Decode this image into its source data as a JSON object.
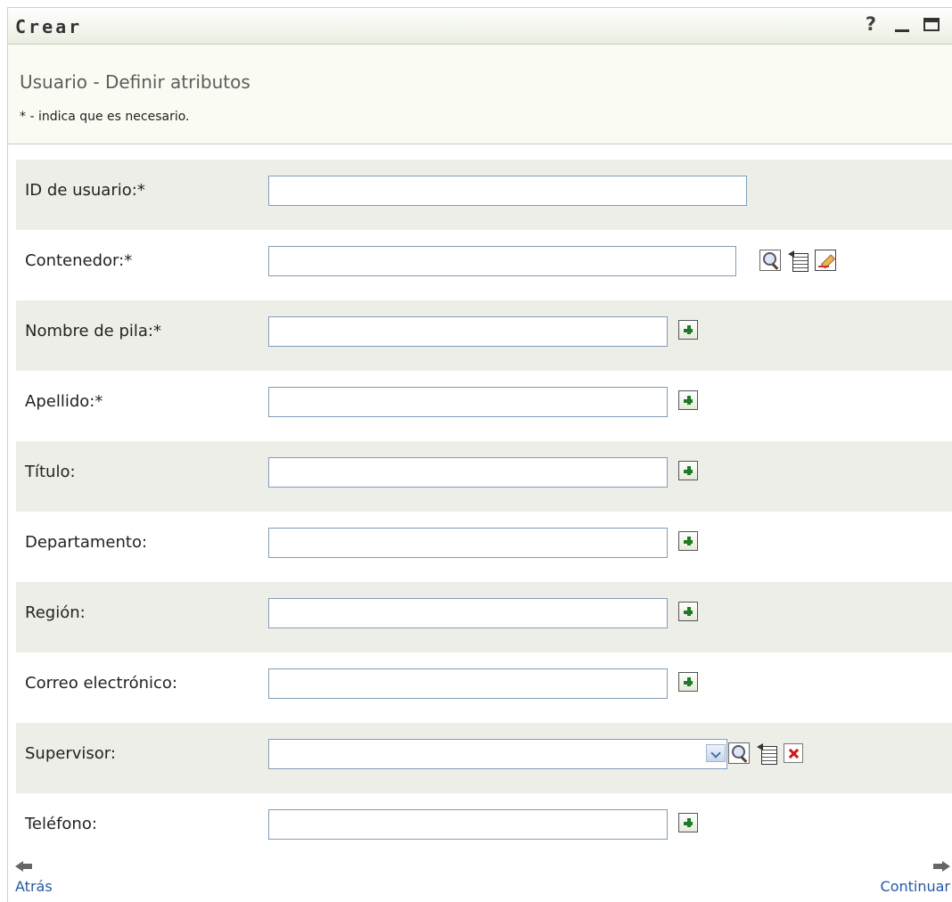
{
  "window": {
    "title": "Crear",
    "help_label": "?",
    "icons": [
      "help-icon",
      "minimize-icon",
      "maximize-icon"
    ]
  },
  "header": {
    "page_title": "Usuario - Definir atributos",
    "required_note": "* - indica que es necesario."
  },
  "form": {
    "fields": [
      {
        "label": "ID de usuario:*",
        "value": "",
        "actions": []
      },
      {
        "label": "Contenedor:*",
        "value": "",
        "actions": [
          "search-icon",
          "history-icon",
          "edit-icon"
        ]
      },
      {
        "label": "Nombre de pila:*",
        "value": "",
        "actions": [
          "plus-icon"
        ]
      },
      {
        "label": "Apellido:*",
        "value": "",
        "actions": [
          "plus-icon"
        ]
      },
      {
        "label": "Título:",
        "value": "",
        "actions": [
          "plus-icon"
        ]
      },
      {
        "label": "Departamento:",
        "value": "",
        "actions": [
          "plus-icon"
        ]
      },
      {
        "label": "Región:",
        "value": "",
        "actions": [
          "plus-icon"
        ]
      },
      {
        "label": "Correo electrónico:",
        "value": "",
        "actions": [
          "plus-icon"
        ]
      },
      {
        "label": "Supervisor:",
        "value": "",
        "actions": [
          "chevron-down-icon",
          "search-icon",
          "history-icon",
          "clear-icon"
        ]
      },
      {
        "label": "Teléfono:",
        "value": "",
        "actions": [
          "plus-icon"
        ]
      }
    ]
  },
  "nav": {
    "back_label": "Atrás",
    "next_label": "Continuar"
  },
  "colors": {
    "title_bar": "#e9eee0",
    "header_bg": "#fafcf3",
    "row_shade": "#eeeee9",
    "link": "#2458a6",
    "plus": "#1f7a28",
    "clear": "#d01818"
  }
}
